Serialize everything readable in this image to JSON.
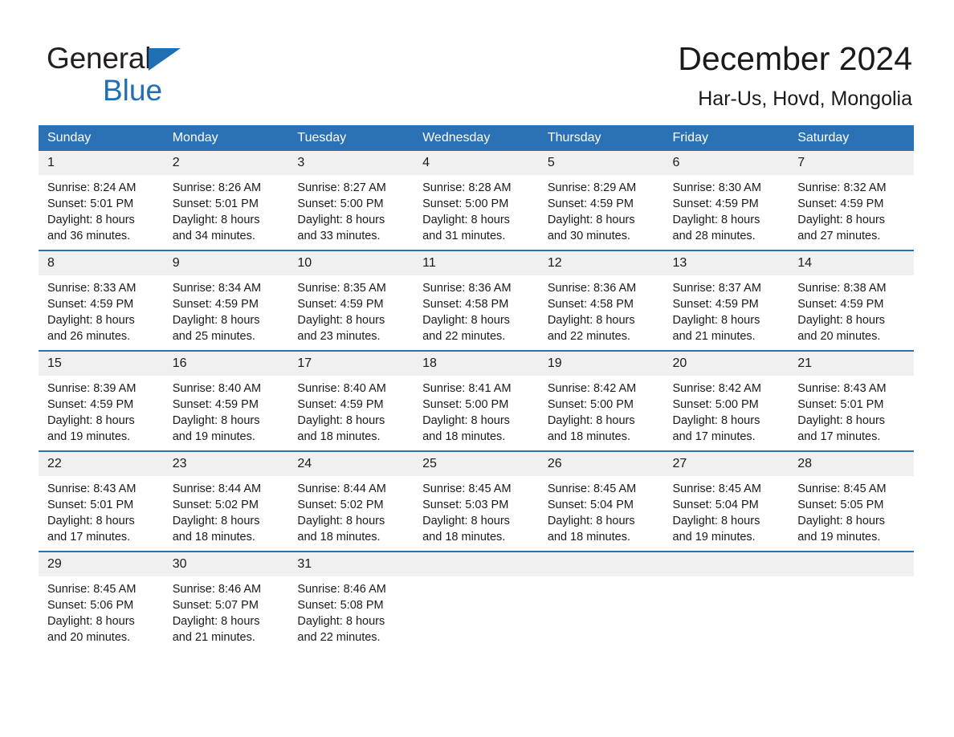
{
  "brand": {
    "name_part1": "General",
    "name_part2": "Blue",
    "triangle_color": "#1f6fb4"
  },
  "header": {
    "title": "December 2024",
    "subtitle": "Har-Us, Hovd, Mongolia"
  },
  "theme": {
    "header_blue": "#2a72b5",
    "daynum_gray": "#f0f0f0",
    "text_color": "#1a1a1a"
  },
  "calendar": {
    "weekday_headers": [
      "Sunday",
      "Monday",
      "Tuesday",
      "Wednesday",
      "Thursday",
      "Friday",
      "Saturday"
    ],
    "weeks": [
      [
        {
          "day": "1",
          "sunrise": "Sunrise: 8:24 AM",
          "sunset": "Sunset: 5:01 PM",
          "daylight_line1": "Daylight: 8 hours",
          "daylight_line2": "and 36 minutes."
        },
        {
          "day": "2",
          "sunrise": "Sunrise: 8:26 AM",
          "sunset": "Sunset: 5:01 PM",
          "daylight_line1": "Daylight: 8 hours",
          "daylight_line2": "and 34 minutes."
        },
        {
          "day": "3",
          "sunrise": "Sunrise: 8:27 AM",
          "sunset": "Sunset: 5:00 PM",
          "daylight_line1": "Daylight: 8 hours",
          "daylight_line2": "and 33 minutes."
        },
        {
          "day": "4",
          "sunrise": "Sunrise: 8:28 AM",
          "sunset": "Sunset: 5:00 PM",
          "daylight_line1": "Daylight: 8 hours",
          "daylight_line2": "and 31 minutes."
        },
        {
          "day": "5",
          "sunrise": "Sunrise: 8:29 AM",
          "sunset": "Sunset: 4:59 PM",
          "daylight_line1": "Daylight: 8 hours",
          "daylight_line2": "and 30 minutes."
        },
        {
          "day": "6",
          "sunrise": "Sunrise: 8:30 AM",
          "sunset": "Sunset: 4:59 PM",
          "daylight_line1": "Daylight: 8 hours",
          "daylight_line2": "and 28 minutes."
        },
        {
          "day": "7",
          "sunrise": "Sunrise: 8:32 AM",
          "sunset": "Sunset: 4:59 PM",
          "daylight_line1": "Daylight: 8 hours",
          "daylight_line2": "and 27 minutes."
        }
      ],
      [
        {
          "day": "8",
          "sunrise": "Sunrise: 8:33 AM",
          "sunset": "Sunset: 4:59 PM",
          "daylight_line1": "Daylight: 8 hours",
          "daylight_line2": "and 26 minutes."
        },
        {
          "day": "9",
          "sunrise": "Sunrise: 8:34 AM",
          "sunset": "Sunset: 4:59 PM",
          "daylight_line1": "Daylight: 8 hours",
          "daylight_line2": "and 25 minutes."
        },
        {
          "day": "10",
          "sunrise": "Sunrise: 8:35 AM",
          "sunset": "Sunset: 4:59 PM",
          "daylight_line1": "Daylight: 8 hours",
          "daylight_line2": "and 23 minutes."
        },
        {
          "day": "11",
          "sunrise": "Sunrise: 8:36 AM",
          "sunset": "Sunset: 4:58 PM",
          "daylight_line1": "Daylight: 8 hours",
          "daylight_line2": "and 22 minutes."
        },
        {
          "day": "12",
          "sunrise": "Sunrise: 8:36 AM",
          "sunset": "Sunset: 4:58 PM",
          "daylight_line1": "Daylight: 8 hours",
          "daylight_line2": "and 22 minutes."
        },
        {
          "day": "13",
          "sunrise": "Sunrise: 8:37 AM",
          "sunset": "Sunset: 4:59 PM",
          "daylight_line1": "Daylight: 8 hours",
          "daylight_line2": "and 21 minutes."
        },
        {
          "day": "14",
          "sunrise": "Sunrise: 8:38 AM",
          "sunset": "Sunset: 4:59 PM",
          "daylight_line1": "Daylight: 8 hours",
          "daylight_line2": "and 20 minutes."
        }
      ],
      [
        {
          "day": "15",
          "sunrise": "Sunrise: 8:39 AM",
          "sunset": "Sunset: 4:59 PM",
          "daylight_line1": "Daylight: 8 hours",
          "daylight_line2": "and 19 minutes."
        },
        {
          "day": "16",
          "sunrise": "Sunrise: 8:40 AM",
          "sunset": "Sunset: 4:59 PM",
          "daylight_line1": "Daylight: 8 hours",
          "daylight_line2": "and 19 minutes."
        },
        {
          "day": "17",
          "sunrise": "Sunrise: 8:40 AM",
          "sunset": "Sunset: 4:59 PM",
          "daylight_line1": "Daylight: 8 hours",
          "daylight_line2": "and 18 minutes."
        },
        {
          "day": "18",
          "sunrise": "Sunrise: 8:41 AM",
          "sunset": "Sunset: 5:00 PM",
          "daylight_line1": "Daylight: 8 hours",
          "daylight_line2": "and 18 minutes."
        },
        {
          "day": "19",
          "sunrise": "Sunrise: 8:42 AM",
          "sunset": "Sunset: 5:00 PM",
          "daylight_line1": "Daylight: 8 hours",
          "daylight_line2": "and 18 minutes."
        },
        {
          "day": "20",
          "sunrise": "Sunrise: 8:42 AM",
          "sunset": "Sunset: 5:00 PM",
          "daylight_line1": "Daylight: 8 hours",
          "daylight_line2": "and 17 minutes."
        },
        {
          "day": "21",
          "sunrise": "Sunrise: 8:43 AM",
          "sunset": "Sunset: 5:01 PM",
          "daylight_line1": "Daylight: 8 hours",
          "daylight_line2": "and 17 minutes."
        }
      ],
      [
        {
          "day": "22",
          "sunrise": "Sunrise: 8:43 AM",
          "sunset": "Sunset: 5:01 PM",
          "daylight_line1": "Daylight: 8 hours",
          "daylight_line2": "and 17 minutes."
        },
        {
          "day": "23",
          "sunrise": "Sunrise: 8:44 AM",
          "sunset": "Sunset: 5:02 PM",
          "daylight_line1": "Daylight: 8 hours",
          "daylight_line2": "and 18 minutes."
        },
        {
          "day": "24",
          "sunrise": "Sunrise: 8:44 AM",
          "sunset": "Sunset: 5:02 PM",
          "daylight_line1": "Daylight: 8 hours",
          "daylight_line2": "and 18 minutes."
        },
        {
          "day": "25",
          "sunrise": "Sunrise: 8:45 AM",
          "sunset": "Sunset: 5:03 PM",
          "daylight_line1": "Daylight: 8 hours",
          "daylight_line2": "and 18 minutes."
        },
        {
          "day": "26",
          "sunrise": "Sunrise: 8:45 AM",
          "sunset": "Sunset: 5:04 PM",
          "daylight_line1": "Daylight: 8 hours",
          "daylight_line2": "and 18 minutes."
        },
        {
          "day": "27",
          "sunrise": "Sunrise: 8:45 AM",
          "sunset": "Sunset: 5:04 PM",
          "daylight_line1": "Daylight: 8 hours",
          "daylight_line2": "and 19 minutes."
        },
        {
          "day": "28",
          "sunrise": "Sunrise: 8:45 AM",
          "sunset": "Sunset: 5:05 PM",
          "daylight_line1": "Daylight: 8 hours",
          "daylight_line2": "and 19 minutes."
        }
      ],
      [
        {
          "day": "29",
          "sunrise": "Sunrise: 8:45 AM",
          "sunset": "Sunset: 5:06 PM",
          "daylight_line1": "Daylight: 8 hours",
          "daylight_line2": "and 20 minutes."
        },
        {
          "day": "30",
          "sunrise": "Sunrise: 8:46 AM",
          "sunset": "Sunset: 5:07 PM",
          "daylight_line1": "Daylight: 8 hours",
          "daylight_line2": "and 21 minutes."
        },
        {
          "day": "31",
          "sunrise": "Sunrise: 8:46 AM",
          "sunset": "Sunset: 5:08 PM",
          "daylight_line1": "Daylight: 8 hours",
          "daylight_line2": "and 22 minutes."
        },
        {
          "day": "",
          "sunrise": "",
          "sunset": "",
          "daylight_line1": "",
          "daylight_line2": ""
        },
        {
          "day": "",
          "sunrise": "",
          "sunset": "",
          "daylight_line1": "",
          "daylight_line2": ""
        },
        {
          "day": "",
          "sunrise": "",
          "sunset": "",
          "daylight_line1": "",
          "daylight_line2": ""
        },
        {
          "day": "",
          "sunrise": "",
          "sunset": "",
          "daylight_line1": "",
          "daylight_line2": ""
        }
      ]
    ]
  }
}
